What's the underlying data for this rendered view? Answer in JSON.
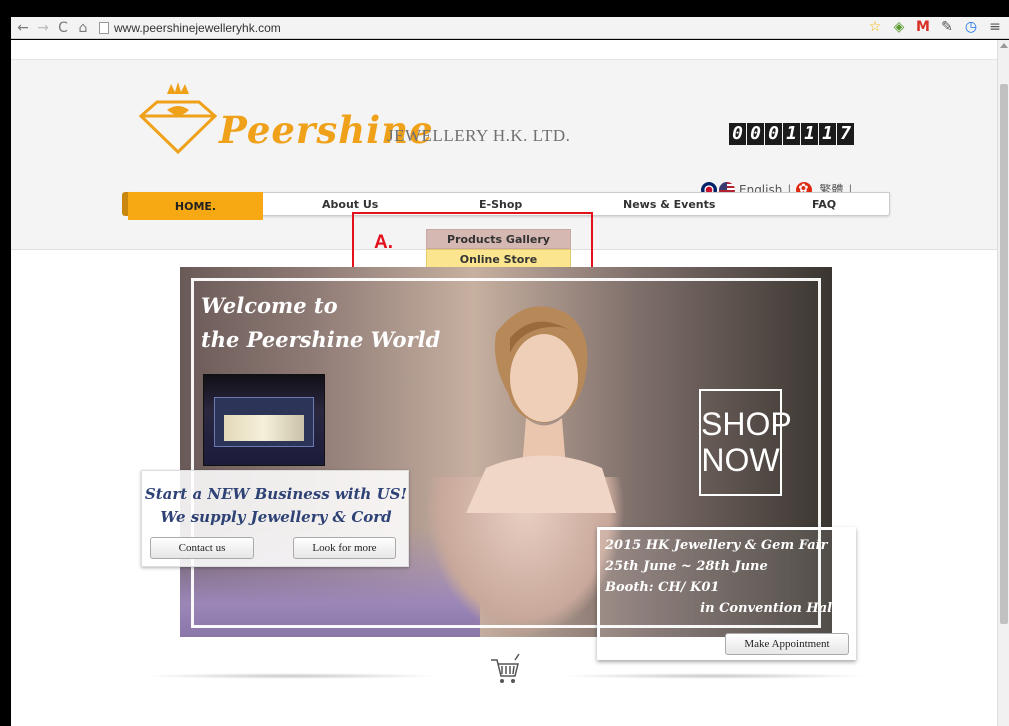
{
  "browser": {
    "url": "www.peershinejewelleryhk.com"
  },
  "header": {
    "brand": "Peershine",
    "company": "JEWELLERY H.K. LTD.",
    "counter": [
      "0",
      "0",
      "0",
      "1",
      "1",
      "1",
      "7"
    ],
    "lang": {
      "english": "English",
      "sep": "|",
      "trad_chinese": "繁體"
    }
  },
  "nav": {
    "home": "HOME.",
    "about": "About Us",
    "eshop": "E-Shop",
    "news": "News & Events",
    "faq": "FAQ"
  },
  "dropdown": {
    "gallery": "Products Gallery",
    "store": "Online Store"
  },
  "annotation": {
    "label": "A."
  },
  "banner": {
    "welcome1": "Welcome to",
    "welcome2": "the Peershine World",
    "shop1": "SHOP",
    "shop2": "NOW",
    "start1": "Start a NEW Business with US!",
    "start2": "We supply Jewellery & Cord",
    "contact": "Contact us",
    "more": "Look for more",
    "fair1": "2015 HK Jewellery & Gem Fair",
    "fair2": "25th June ~ 28th June",
    "fair3": "Booth: CH/ K01",
    "fair4": "in Convention Hall",
    "appointment": "Make Appointment"
  },
  "colors": {
    "brand_orange": "#f0a11a",
    "annotation_red": "#e3111c",
    "gallery_bg": "#d6b8b2",
    "store_bg": "#fbe58f"
  }
}
